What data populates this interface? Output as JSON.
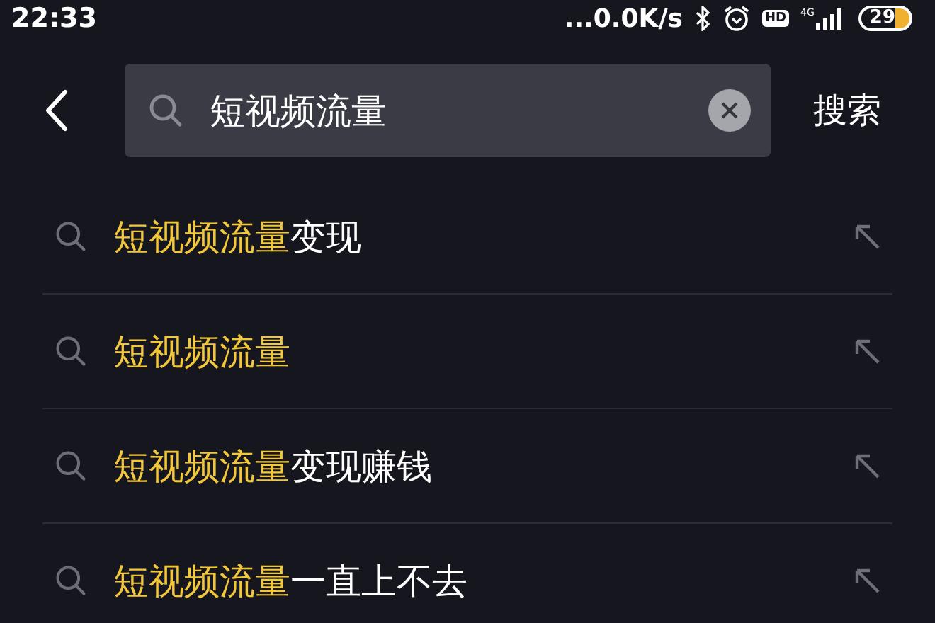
{
  "status_bar": {
    "time": "22:33",
    "speed": "...0.0K/s",
    "hd": "HD",
    "network": "4G",
    "battery": "29"
  },
  "search": {
    "value": "短视频流量",
    "submit": "搜索"
  },
  "suggestions": [
    {
      "match": "短视频流量",
      "rest": "变现"
    },
    {
      "match": "短视频流量"
    },
    {
      "match": "短视频流量",
      "rest": "变现赚钱"
    },
    {
      "match": "短视频流量",
      "rest": "一直上不去"
    }
  ]
}
